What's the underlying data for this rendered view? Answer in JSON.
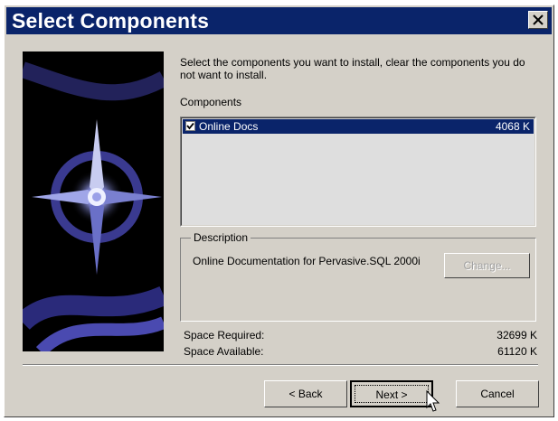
{
  "window": {
    "title": "Select Components"
  },
  "intro": "Select the components you want to install, clear the components you do not want to install.",
  "components": {
    "label": "Components",
    "items": [
      {
        "name": "Online Docs",
        "size": "4068 K",
        "checked": true
      }
    ]
  },
  "description": {
    "label": "Description",
    "text": "Online Documentation for Pervasive.SQL 2000i",
    "change_button": "Change..."
  },
  "space": {
    "required_label": "Space Required:",
    "required_value": "32699 K",
    "available_label": "Space Available:",
    "available_value": "61120 K"
  },
  "buttons": {
    "back": "< Back",
    "next": "Next >",
    "cancel": "Cancel"
  },
  "icons": {
    "close": "close-icon",
    "checkbox": "checkmark-icon",
    "cursor": "mouse-pointer-icon"
  },
  "colors": {
    "titlebar": "#0a246a",
    "face": "#d4d0c8",
    "selection": "#0a246a"
  }
}
